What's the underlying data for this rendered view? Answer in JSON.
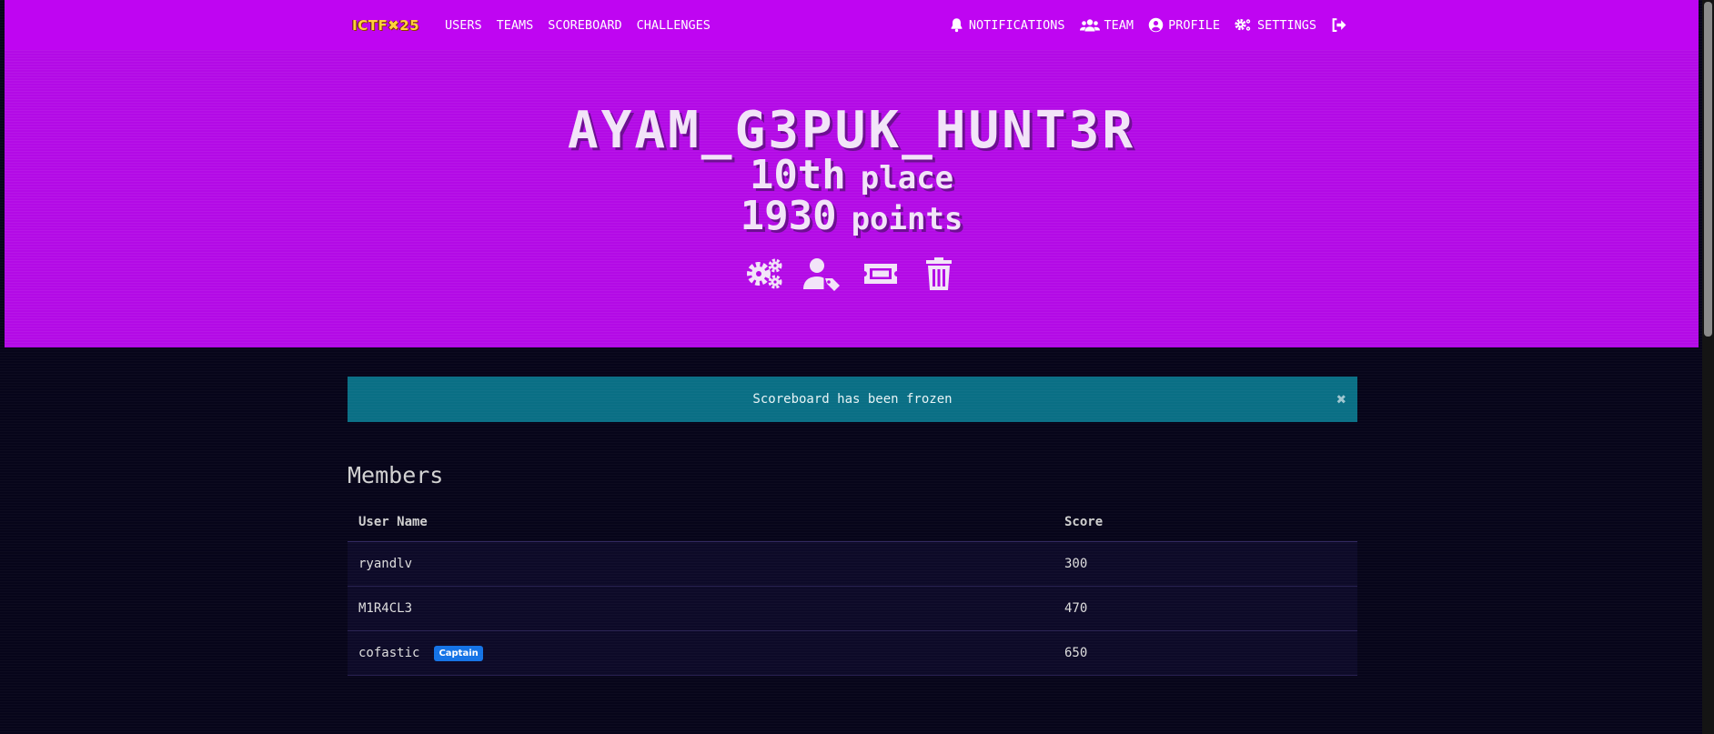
{
  "nav": {
    "brand": "ICTF✖25",
    "links": [
      "Users",
      "Teams",
      "Scoreboard",
      "Challenges"
    ],
    "right": {
      "notifications": "Notifications",
      "team": "Team",
      "profile": "Profile",
      "settings": "Settings",
      "logout_icon": "sign-out-icon"
    }
  },
  "hero": {
    "team_name": "AYAM_G3PUK_HUNT3R",
    "place_value": "10th",
    "place_label": "place",
    "points_value": "1930",
    "points_label": "points",
    "actions": [
      "settings-icon",
      "user-tag-icon",
      "ticket-icon",
      "trash-icon"
    ]
  },
  "alert": {
    "message": "Scoreboard has been frozen",
    "close": "✖"
  },
  "members": {
    "title": "Members",
    "columns": [
      "User Name",
      "Score"
    ],
    "rows": [
      {
        "name": "ryandlv",
        "score": "300",
        "badge": ""
      },
      {
        "name": "M1R4CL3",
        "score": "470",
        "badge": ""
      },
      {
        "name": "cofastic",
        "score": "650",
        "badge": "Captain"
      }
    ]
  },
  "colors": {
    "navbar": "#bf05f2",
    "hero": "#b30ae6",
    "alert": "#0a6f85",
    "background": "#07051a",
    "badge": "#1473e6"
  }
}
